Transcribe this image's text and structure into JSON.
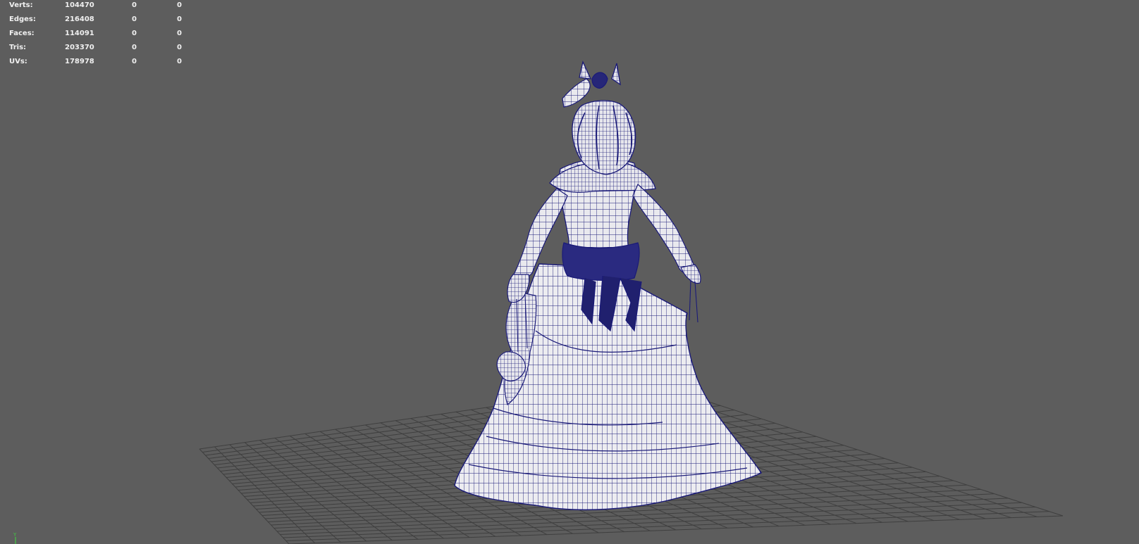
{
  "hud": {
    "rows": [
      {
        "label": "Verts:",
        "total": "104470",
        "selected": "0",
        "component": "0"
      },
      {
        "label": "Edges:",
        "total": "216408",
        "selected": "0",
        "component": "0"
      },
      {
        "label": "Faces:",
        "total": "114091",
        "selected": "0",
        "component": "0"
      },
      {
        "label": "Tris:",
        "total": "203370",
        "selected": "0",
        "component": "0"
      },
      {
        "label": "UVs:",
        "total": "178978",
        "selected": "0",
        "component": "0"
      }
    ]
  },
  "axis_indicator": {
    "label": "Y"
  },
  "colors": {
    "viewport_bg": "#5d5d5d",
    "grid": "#3f3f3f",
    "wireframe": "#1a1a78",
    "mesh_fill": "#e9e9ee",
    "hud_text": "#f0f0f0",
    "axis_y": "#43c943"
  }
}
